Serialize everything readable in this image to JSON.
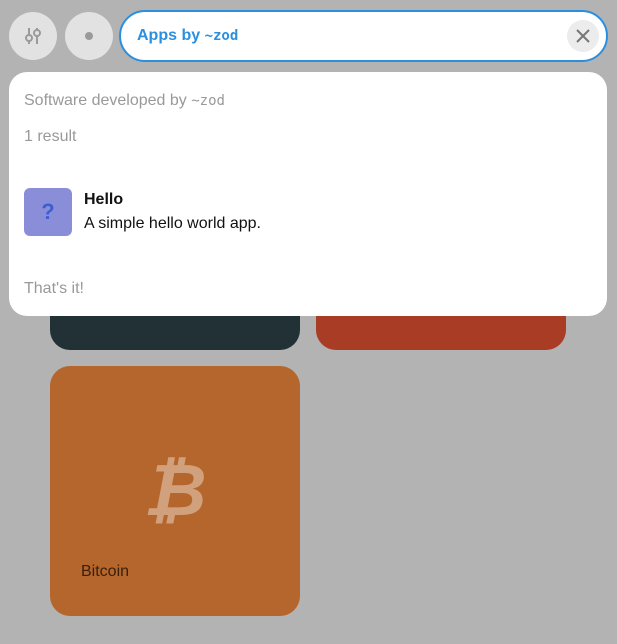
{
  "search": {
    "prefix": "Apps by ",
    "ship": "~zod"
  },
  "dropdown": {
    "heading_prefix": "Software developed by ",
    "heading_ship": "~zod",
    "count": "1 result",
    "results": [
      {
        "title": "Hello",
        "description": "A simple hello world app.",
        "icon_glyph": "?",
        "icon_color": "#8a8ed8"
      }
    ],
    "end_text": "That's it!"
  },
  "tiles": [
    {
      "name": "",
      "color": "#213136"
    },
    {
      "name": "",
      "color": "#a83c24"
    },
    {
      "name": "Bitcoin",
      "color": "#b5662c",
      "logo": "₿"
    }
  ],
  "icons": {
    "settings": "sliders-icon",
    "dot": "dot-icon",
    "clear": "close-icon"
  },
  "colors": {
    "accent": "#2b8fe0",
    "background": "#b3b3b3"
  }
}
